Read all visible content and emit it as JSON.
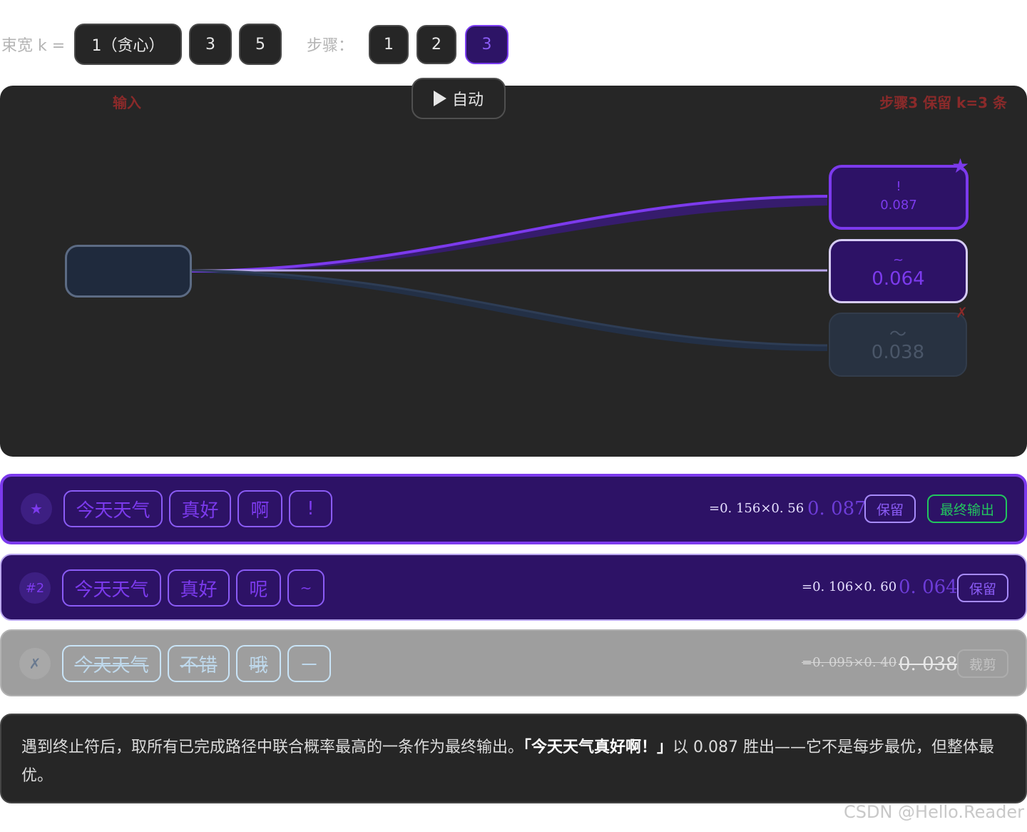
{
  "controls": {
    "beam_label": "束宽 k =",
    "beam_options": [
      "1（贪心）",
      "3",
      "5"
    ],
    "beam_selected": "3",
    "step_label": "步骤：",
    "step_options": [
      "1",
      "2",
      "3"
    ],
    "step_selected": "3",
    "auto_label": "自动"
  },
  "canvas": {
    "input_label": "输入",
    "status_label": "步骤3 保留 k=3 条",
    "nodes": [
      {
        "token": "!",
        "prob": "0.087",
        "state": "best",
        "mark": "★"
      },
      {
        "token": "~",
        "prob": "0.064",
        "state": "kept"
      },
      {
        "token": "～",
        "prob": "0.038",
        "state": "pruned",
        "mark": "✗"
      }
    ]
  },
  "beams": [
    {
      "badge": "★",
      "tokens": [
        "今天天气",
        "真好",
        "啊",
        "!"
      ],
      "formula": "=0. 156×0. 56",
      "prob": "0. 087",
      "tags": [
        "保留",
        "最终输出"
      ],
      "state": "best"
    },
    {
      "badge": "#2",
      "tokens": [
        "今天天气",
        "真好",
        "呢",
        "~"
      ],
      "formula": "=0. 106×0. 60",
      "prob": "0. 064",
      "tags": [
        "保留"
      ],
      "state": "kept"
    },
    {
      "badge": "✗",
      "tokens": [
        "今天天气",
        "不错",
        "哦",
        "—"
      ],
      "formula": "=0. 095×0. 40",
      "prob": "0. 038",
      "tags": [
        "裁剪"
      ],
      "state": "pruned"
    }
  ],
  "explanation": {
    "before": "遇到终止符后，取所有已完成路径中联合概率最高的一条作为最终输出。",
    "highlight": "「今天天气真好啊！」",
    "after": "以 0.087 胜出——它不是每步最优，但整体最优。"
  },
  "watermark": "CSDN @Hello.Reader",
  "colors": {
    "accent": "#7a3cf0",
    "accent_text": "#8b5cf6",
    "row_bg": "#2d1266",
    "pruned_bg": "#9e9e9e",
    "final_green": "#22c55e",
    "canvas_bg": "#262626"
  }
}
